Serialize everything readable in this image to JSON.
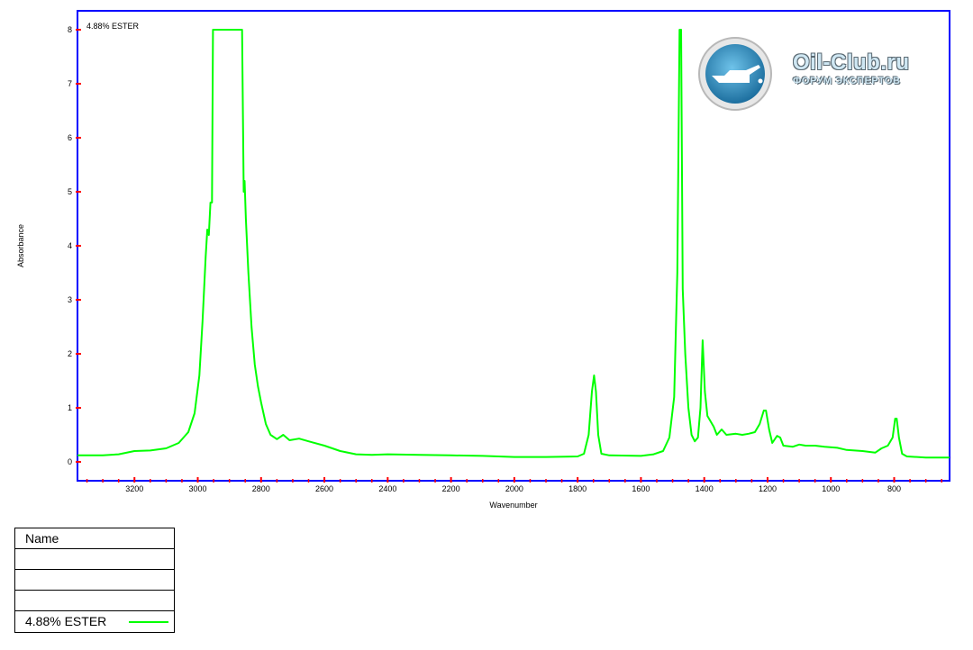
{
  "chart_data": {
    "type": "line",
    "xlabel": "Wavenumber",
    "ylabel": "Absorbance",
    "x_reversed": true,
    "xlim": [
      3380,
      625
    ],
    "ylim": [
      -0.35,
      8.35
    ],
    "x_ticks": [
      3200,
      3000,
      2800,
      2600,
      2400,
      2200,
      2000,
      1800,
      1600,
      1400,
      1200,
      1000,
      800
    ],
    "y_ticks": [
      0,
      1,
      2,
      3,
      4,
      5,
      6,
      7,
      8
    ],
    "grid": false,
    "annotation": "4.88% ESTER",
    "series": [
      {
        "name": "4.88% ESTER",
        "color": "#00ff00",
        "points": [
          [
            3380,
            0.12
          ],
          [
            3300,
            0.12
          ],
          [
            3250,
            0.14
          ],
          [
            3200,
            0.2
          ],
          [
            3150,
            0.21
          ],
          [
            3100,
            0.25
          ],
          [
            3060,
            0.35
          ],
          [
            3030,
            0.55
          ],
          [
            3010,
            0.9
          ],
          [
            2995,
            1.6
          ],
          [
            2985,
            2.6
          ],
          [
            2975,
            3.8
          ],
          [
            2970,
            4.3
          ],
          [
            2965,
            4.2
          ],
          [
            2960,
            4.8
          ],
          [
            2955,
            4.8
          ],
          [
            2952,
            8.0
          ],
          [
            2935,
            8.0
          ],
          [
            2900,
            8.0
          ],
          [
            2860,
            8.0
          ],
          [
            2855,
            5.0
          ],
          [
            2852,
            5.2
          ],
          [
            2848,
            4.5
          ],
          [
            2840,
            3.5
          ],
          [
            2830,
            2.5
          ],
          [
            2820,
            1.8
          ],
          [
            2810,
            1.4
          ],
          [
            2800,
            1.1
          ],
          [
            2785,
            0.7
          ],
          [
            2770,
            0.5
          ],
          [
            2750,
            0.42
          ],
          [
            2730,
            0.5
          ],
          [
            2710,
            0.4
          ],
          [
            2680,
            0.43
          ],
          [
            2650,
            0.38
          ],
          [
            2600,
            0.3
          ],
          [
            2550,
            0.2
          ],
          [
            2500,
            0.14
          ],
          [
            2450,
            0.13
          ],
          [
            2400,
            0.14
          ],
          [
            2300,
            0.13
          ],
          [
            2200,
            0.12
          ],
          [
            2100,
            0.11
          ],
          [
            2050,
            0.1
          ],
          [
            2000,
            0.09
          ],
          [
            1900,
            0.09
          ],
          [
            1800,
            0.1
          ],
          [
            1780,
            0.15
          ],
          [
            1765,
            0.5
          ],
          [
            1755,
            1.3
          ],
          [
            1748,
            1.6
          ],
          [
            1742,
            1.3
          ],
          [
            1735,
            0.5
          ],
          [
            1725,
            0.15
          ],
          [
            1700,
            0.12
          ],
          [
            1600,
            0.11
          ],
          [
            1560,
            0.14
          ],
          [
            1530,
            0.2
          ],
          [
            1510,
            0.45
          ],
          [
            1495,
            1.2
          ],
          [
            1485,
            3.5
          ],
          [
            1478,
            8.0
          ],
          [
            1473,
            8.0
          ],
          [
            1468,
            3.2
          ],
          [
            1460,
            2.0
          ],
          [
            1450,
            1.0
          ],
          [
            1440,
            0.5
          ],
          [
            1430,
            0.38
          ],
          [
            1420,
            0.45
          ],
          [
            1412,
            1.0
          ],
          [
            1405,
            2.25
          ],
          [
            1398,
            1.3
          ],
          [
            1390,
            0.85
          ],
          [
            1380,
            0.75
          ],
          [
            1370,
            0.65
          ],
          [
            1360,
            0.5
          ],
          [
            1345,
            0.6
          ],
          [
            1330,
            0.5
          ],
          [
            1300,
            0.52
          ],
          [
            1280,
            0.5
          ],
          [
            1260,
            0.52
          ],
          [
            1240,
            0.55
          ],
          [
            1225,
            0.7
          ],
          [
            1212,
            0.95
          ],
          [
            1205,
            0.95
          ],
          [
            1195,
            0.6
          ],
          [
            1185,
            0.35
          ],
          [
            1170,
            0.48
          ],
          [
            1160,
            0.45
          ],
          [
            1150,
            0.3
          ],
          [
            1120,
            0.28
          ],
          [
            1100,
            0.32
          ],
          [
            1080,
            0.3
          ],
          [
            1050,
            0.3
          ],
          [
            1020,
            0.28
          ],
          [
            980,
            0.26
          ],
          [
            950,
            0.22
          ],
          [
            900,
            0.2
          ],
          [
            860,
            0.17
          ],
          [
            840,
            0.25
          ],
          [
            820,
            0.3
          ],
          [
            805,
            0.45
          ],
          [
            797,
            0.8
          ],
          [
            792,
            0.8
          ],
          [
            785,
            0.45
          ],
          [
            775,
            0.15
          ],
          [
            760,
            0.1
          ],
          [
            700,
            0.08
          ],
          [
            625,
            0.08
          ]
        ]
      }
    ]
  },
  "legend": {
    "header": "Name",
    "rows": [
      "",
      "",
      ""
    ],
    "entry_label": "4.88% ESTER"
  },
  "logo": {
    "title": "Oil-Club.ru",
    "subtitle": "ФОРУМ ЭКСПЕРТОВ"
  }
}
